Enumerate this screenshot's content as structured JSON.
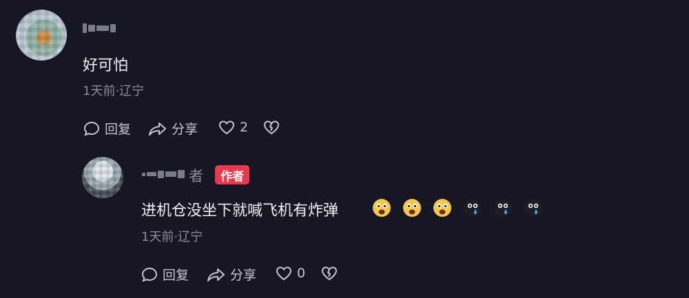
{
  "comments": [
    {
      "text": "好可怕",
      "meta": "1天前·辽宁",
      "actions": {
        "reply": "回复",
        "share": "分享",
        "likes": "2"
      }
    },
    {
      "name_tail": "者",
      "badge": "作者",
      "text": "进机仓没坐下就喊飞机有炸弹",
      "emojis": [
        "frightened-face-icon",
        "frightened-face-icon",
        "frightened-face-icon",
        "crying-black-face-icon",
        "crying-black-face-icon",
        "crying-black-face-icon"
      ],
      "meta": "1天前·辽宁",
      "actions": {
        "reply": "回复",
        "share": "分享",
        "likes": "0"
      }
    }
  ],
  "colors": {
    "background": "#161722",
    "badge": "#e8394f",
    "meta": "#8c8d98"
  }
}
